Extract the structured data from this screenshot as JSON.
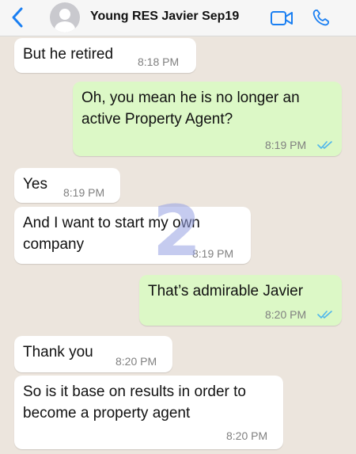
{
  "header": {
    "contact_name": "Young RES Javier Sep19",
    "back_icon": "chevron-left-icon",
    "video_icon": "video-call-icon",
    "phone_icon": "phone-call-icon",
    "accent_color": "#1a7ff2"
  },
  "messages": [
    {
      "direction": "incoming",
      "lines": [
        "But he retired"
      ],
      "time": "8:18 PM"
    },
    {
      "direction": "outgoing",
      "lines": [
        "Oh, you mean he is no longer an",
        "active Property Agent?"
      ],
      "time": "8:19 PM",
      "status": "read"
    },
    {
      "direction": "incoming",
      "lines": [
        "Yes"
      ],
      "time": "8:19 PM"
    },
    {
      "direction": "incoming",
      "lines": [
        "And I want to start my own",
        "company"
      ],
      "time": "8:19 PM"
    },
    {
      "direction": "outgoing",
      "lines": [
        "That’s admirable Javier"
      ],
      "time": "8:20 PM",
      "status": "read"
    },
    {
      "direction": "incoming",
      "lines": [
        "Thank you"
      ],
      "time": "8:20 PM"
    },
    {
      "direction": "incoming",
      "lines": [
        "So is it base on results in order to",
        "become a property agent"
      ],
      "time": "8:20 PM"
    }
  ],
  "watermark": "2",
  "colors": {
    "background": "#ece5dd",
    "incoming_bubble": "#ffffff",
    "outgoing_bubble": "#dcf8c6",
    "read_ticks": "#4fb6ec"
  }
}
